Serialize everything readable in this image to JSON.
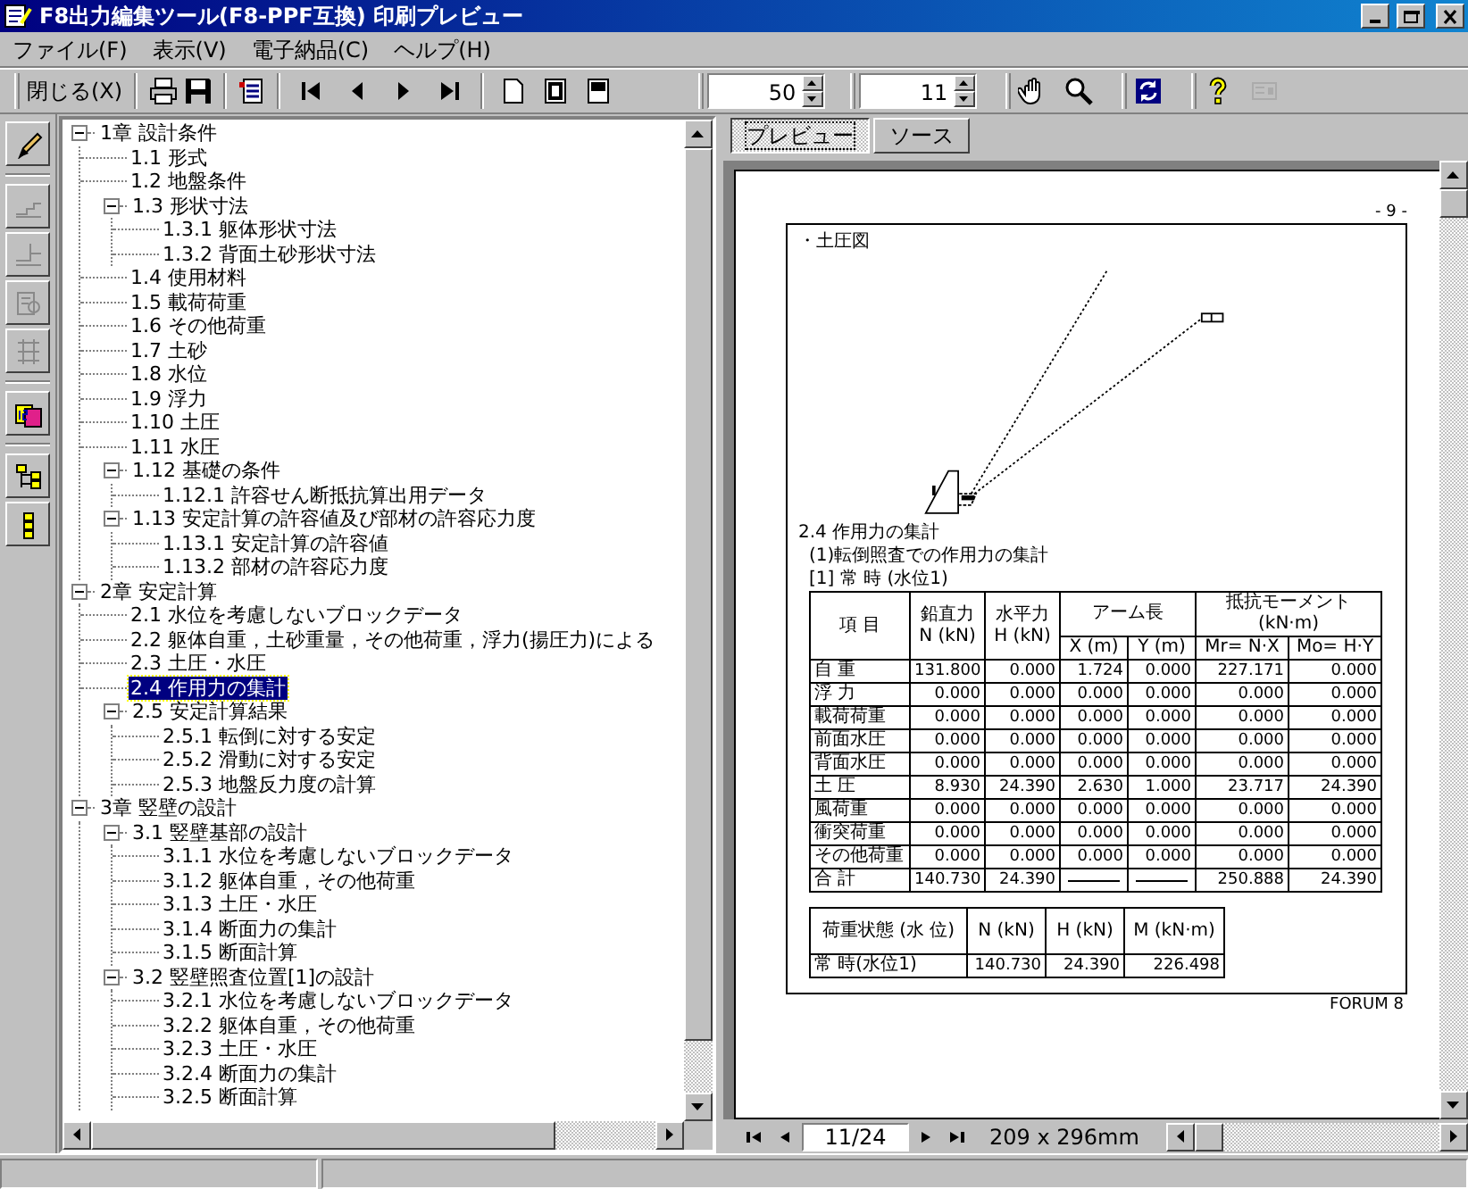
{
  "window": {
    "title": "F8出力編集ツール(F8-PPF互換) 印刷プレビュー"
  },
  "menu": [
    "ファイル(F)",
    "表示(V)",
    "電子納品(C)",
    "ヘルプ(H)"
  ],
  "toolbar": {
    "close_button": "閉じる(X)",
    "zoom_field": "50",
    "font_size_field": "11",
    "tools": [
      {
        "disabled": false
      },
      {
        "disabled": false
      },
      {
        "disabled": false
      },
      {
        "disabled": false
      },
      {
        "disabled": false
      },
      {
        "disabled": false
      },
      {
        "disabled": false
      },
      {
        "disabled": false
      },
      {
        "disabled": false
      },
      {
        "disabled": false
      },
      {
        "disabled": false
      },
      {
        "disabled": false
      },
      {
        "disabled": false
      },
      {
        "disabled": false
      },
      {
        "disabled": true
      }
    ]
  },
  "side_tools": [
    {
      "disabled": false
    },
    {
      "disabled": true
    },
    {
      "disabled": true
    },
    {
      "disabled": true
    },
    {
      "disabled": true
    },
    {
      "disabled": false
    },
    {
      "disabled": false
    },
    {
      "disabled": false
    }
  ],
  "tree": [
    {
      "label": "1章 設計条件",
      "expanded": true,
      "selected": false,
      "children": [
        {
          "label": "1.1 形式",
          "selected": false
        },
        {
          "label": "1.2 地盤条件",
          "selected": false
        },
        {
          "label": "1.3 形状寸法",
          "expanded": true,
          "selected": false,
          "children": [
            {
              "label": "1.3.1 躯体形状寸法",
              "selected": false
            },
            {
              "label": "1.3.2 背面土砂形状寸法",
              "selected": false
            }
          ]
        },
        {
          "label": "1.4 使用材料",
          "selected": false
        },
        {
          "label": "1.5 載荷荷重",
          "selected": false
        },
        {
          "label": "1.6 その他荷重",
          "selected": false
        },
        {
          "label": "1.7 土砂",
          "selected": false
        },
        {
          "label": "1.8 水位",
          "selected": false
        },
        {
          "label": "1.9 浮力",
          "selected": false
        },
        {
          "label": "1.10 土圧",
          "selected": false
        },
        {
          "label": "1.11 水圧",
          "selected": false
        },
        {
          "label": "1.12 基礎の条件",
          "expanded": true,
          "selected": false,
          "children": [
            {
              "label": "1.12.1 許容せん断抵抗算出用データ",
              "selected": false
            }
          ]
        },
        {
          "label": "1.13 安定計算の許容値及び部材の許容応力度",
          "expanded": true,
          "selected": false,
          "children": [
            {
              "label": "1.13.1 安定計算の許容値",
              "selected": false
            },
            {
              "label": "1.13.2 部材の許容応力度",
              "selected": false
            }
          ]
        }
      ]
    },
    {
      "label": "2章 安定計算",
      "expanded": true,
      "selected": false,
      "children": [
        {
          "label": "2.1 水位を考慮しないブロックデータ",
          "selected": false
        },
        {
          "label": "2.2 躯体自重，土砂重量，その他荷重，浮力(揚圧力)による",
          "selected": false
        },
        {
          "label": "2.3 土圧・水圧",
          "selected": false
        },
        {
          "label": "2.4 作用力の集計",
          "selected": true
        },
        {
          "label": "2.5 安定計算結果",
          "expanded": true,
          "selected": false,
          "children": [
            {
              "label": "2.5.1 転倒に対する安定",
              "selected": false
            },
            {
              "label": "2.5.2 滑動に対する安定",
              "selected": false
            },
            {
              "label": "2.5.3 地盤反力度の計算",
              "selected": false
            }
          ]
        }
      ]
    },
    {
      "label": "3章 竪壁の設計",
      "expanded": true,
      "selected": false,
      "children": [
        {
          "label": "3.1 竪壁基部の設計",
          "expanded": true,
          "selected": false,
          "children": [
            {
              "label": "3.1.1 水位を考慮しないブロックデータ",
              "selected": false
            },
            {
              "label": "3.1.2 躯体自重，その他荷重",
              "selected": false
            },
            {
              "label": "3.1.3 土圧・水圧",
              "selected": false
            },
            {
              "label": "3.1.4 断面力の集計",
              "selected": false
            },
            {
              "label": "3.1.5 断面計算",
              "selected": false
            }
          ]
        },
        {
          "label": "3.2 竪壁照査位置[1]の設計",
          "expanded": true,
          "selected": false,
          "children": [
            {
              "label": "3.2.1 水位を考慮しないブロックデータ",
              "selected": false
            },
            {
              "label": "3.2.2 躯体自重，その他荷重",
              "selected": false
            },
            {
              "label": "3.2.3 土圧・水圧",
              "selected": false
            },
            {
              "label": "3.2.4 断面力の集計",
              "selected": false
            },
            {
              "label": "3.2.5 断面計算",
              "selected": false
            }
          ]
        }
      ]
    }
  ],
  "preview": {
    "tabs": [
      {
        "label": "プレビュー",
        "selected": true
      },
      {
        "label": "ソース",
        "selected": false
      }
    ],
    "page": {
      "page_number": "- 9 -",
      "figure_label": "・土圧図",
      "heading": "2.4 作用力の集計",
      "subheading": "(1)転倒照査での作用力の集計",
      "case_label": "[1] 常 時 (水位1)",
      "table": {
        "header_top": [
          "項 目",
          "鉛直力 N (kN)",
          "水平力 H (kN)",
          "アーム長",
          "抵抗モーメント(kN·m)"
        ],
        "header_bottom": [
          "X (m)",
          "Y (m)",
          "Mr= N·X",
          "Mo= H·Y"
        ],
        "rows": [
          [
            "自 重",
            "131.800",
            "0.000",
            "1.724",
            "0.000",
            "227.171",
            "0.000"
          ],
          [
            "浮 力",
            "0.000",
            "0.000",
            "0.000",
            "0.000",
            "0.000",
            "0.000"
          ],
          [
            "載荷荷重",
            "0.000",
            "0.000",
            "0.000",
            "0.000",
            "0.000",
            "0.000"
          ],
          [
            "前面水圧",
            "0.000",
            "0.000",
            "0.000",
            "0.000",
            "0.000",
            "0.000"
          ],
          [
            "背面水圧",
            "0.000",
            "0.000",
            "0.000",
            "0.000",
            "0.000",
            "0.000"
          ],
          [
            "土 圧",
            "8.930",
            "24.390",
            "2.630",
            "1.000",
            "23.717",
            "24.390"
          ],
          [
            "風荷重",
            "0.000",
            "0.000",
            "0.000",
            "0.000",
            "0.000",
            "0.000"
          ],
          [
            "衝突荷重",
            "0.000",
            "0.000",
            "0.000",
            "0.000",
            "0.000",
            "0.000"
          ],
          [
            "その他荷重",
            "0.000",
            "0.000",
            "0.000",
            "0.000",
            "0.000",
            "0.000"
          ],
          [
            "合 計",
            "140.730",
            "24.390",
            null,
            null,
            "250.888",
            "24.390"
          ]
        ]
      },
      "summary_table": {
        "columns": [
          "荷重状態 (水 位)",
          "N (kN)",
          "H (kN)",
          "M (kN·m)"
        ],
        "rows": [
          [
            "常 時(水位1)",
            "140.730",
            "24.390",
            "226.498"
          ]
        ]
      },
      "footer": "FORUM 8"
    },
    "navigation": {
      "page_field": "11/24",
      "paper_size": "209 x 296mm"
    }
  }
}
